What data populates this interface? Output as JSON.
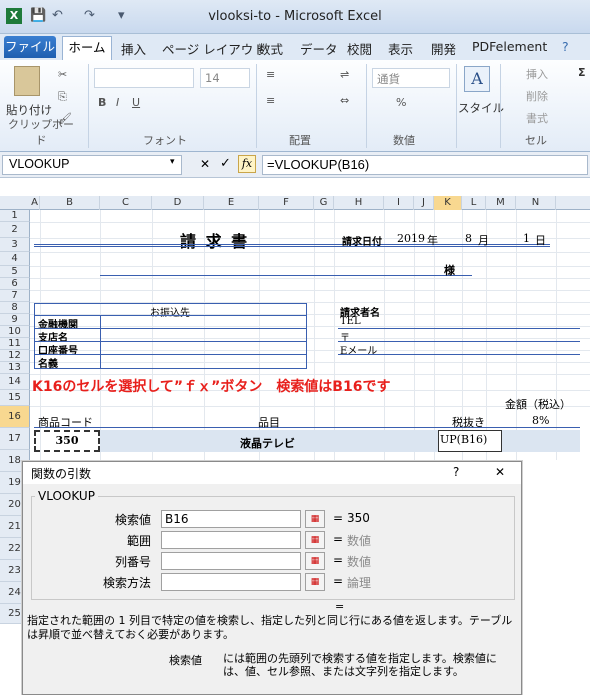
{
  "window": {
    "title": "vlooksi-to  -  Microsoft Excel",
    "min": "–",
    "max": "□",
    "close": "✕"
  },
  "qat": [
    "💾",
    "↶",
    "↷",
    "▾"
  ],
  "tabs": {
    "file": "ファイル",
    "home": "ホーム",
    "insert": "挿入",
    "layout": "ページ レイアウト",
    "formulas": "数式",
    "data": "データ",
    "review": "校閲",
    "view": "表示",
    "dev": "開発",
    "pdf": "PDFelement"
  },
  "ribbon": {
    "paste": "貼り付け",
    "clipboard": "クリップボード",
    "font": "フォント",
    "font_size": "14",
    "align": "配置",
    "number_format": "通貨",
    "number": "数値",
    "style": "スタイル",
    "insert": "挿入",
    "delete": "削除",
    "format": "書式",
    "cells": "セル"
  },
  "formula_bar": {
    "name_box": "VLOOKUP",
    "cancel": "✕",
    "enter": "✓",
    "fx": "fx",
    "formula": "=VLOOKUP(B16)"
  },
  "columns": [
    "A",
    "B",
    "C",
    "D",
    "E",
    "F",
    "G",
    "H",
    "I",
    "J",
    "K",
    "L",
    "M",
    "N"
  ],
  "rows": [
    "1",
    "2",
    "3",
    "4",
    "5",
    "6",
    "7",
    "8",
    "9",
    "10",
    "11",
    "12",
    "13",
    "14",
    "15",
    "16",
    "17",
    "18",
    "19",
    "20",
    "21",
    "22",
    "23",
    "24",
    "25"
  ],
  "sheet": {
    "invoice_title": "請 求 書",
    "date_label": "請求日付",
    "date_year": "2019",
    "year": "年",
    "date_month": "8",
    "month": "月",
    "date_day": "1",
    "day": "日",
    "sama": "様",
    "bank_header": "お振込先",
    "bank_rows": [
      "金融機関",
      "支店名",
      "口座番号",
      "名義"
    ],
    "issuer_header": "請求者名",
    "issuer_rows": [
      "TEL",
      "〒",
      "Eメール"
    ],
    "instruction": "K16のセルを選択して”ｆｘ”ボタン　検索値はB16です",
    "amount_header": "金額（税込）",
    "tax_rate": "8%",
    "col_code": "商品コード",
    "col_item": "品目",
    "col_price": "税抜き",
    "row16_code": "350",
    "row16_item": "液晶テレビ",
    "row16_formula": "UP(B16)"
  },
  "dialog": {
    "title": "関数の引数",
    "help": "?",
    "close": "✕",
    "function": "VLOOKUP",
    "args": [
      {
        "label": "検索値",
        "value": "B16",
        "result": "350"
      },
      {
        "label": "範囲",
        "value": "",
        "result": "数値"
      },
      {
        "label": "列番号",
        "value": "",
        "result": "数値"
      },
      {
        "label": "検索方法",
        "value": "",
        "result": "論理"
      }
    ],
    "eq": "=",
    "description": "指定された範囲の 1 列目で特定の値を検索し、指定した列と同じ行にある値を返します。テーブルは昇順で並べ替えておく必要があります。",
    "arg_help_name": "検索値",
    "arg_help": "には範囲の先頭列で検索する値を指定します。検索値には、値、セル参照、または文字列を指定します。"
  }
}
